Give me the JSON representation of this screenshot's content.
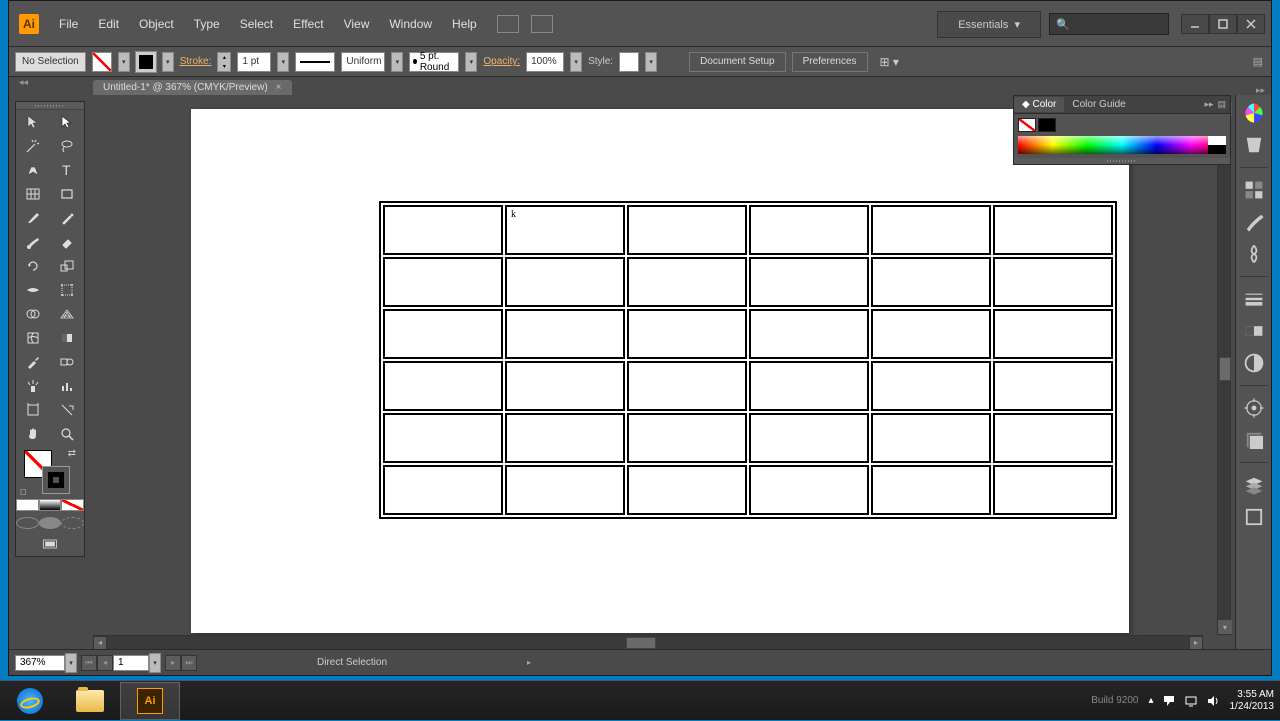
{
  "app": {
    "logo_text": "Ai"
  },
  "menu": {
    "items": [
      "File",
      "Edit",
      "Object",
      "Type",
      "Select",
      "Effect",
      "View",
      "Window",
      "Help"
    ]
  },
  "title_right": {
    "workspace": "Essentials",
    "search_placeholder": ""
  },
  "options_bar": {
    "selection": "No Selection",
    "stroke_label": "Stroke:",
    "stroke_value": "1 pt",
    "profile": "Uniform",
    "brush": "5 pt. Round",
    "opacity_label": "Opacity:",
    "opacity_value": "100%",
    "style_label": "Style:",
    "doc_setup": "Document Setup",
    "preferences": "Preferences"
  },
  "document_tab": {
    "title": "Untitled-1* @ 367% (CMYK/Preview)"
  },
  "canvas": {
    "grid_rows": 6,
    "grid_cols": 6,
    "cursor_char": "k"
  },
  "color_panel": {
    "tab_color": "Color",
    "tab_guide": "Color Guide"
  },
  "status": {
    "zoom": "367%",
    "page": "1",
    "tool": "Direct Selection"
  },
  "taskbar": {
    "time": "3:55 AM",
    "date": "1/24/2013",
    "build": "Build 9200"
  }
}
